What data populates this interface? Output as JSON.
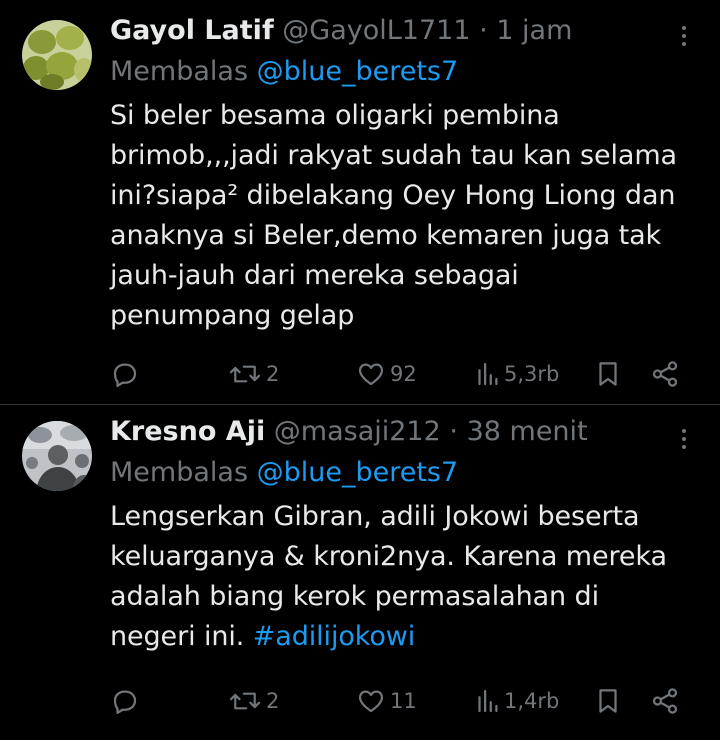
{
  "tweets": [
    {
      "name": "Gayol Latif",
      "handle": "@GayolL1711",
      "separator": "·",
      "time": "1 jam",
      "reply_prefix": "Membalas",
      "reply_to": "@blue_berets7",
      "body_lines": [
        "Si beler besama oligarki pembina",
        "brimob,,,jadi rakyat sudah tau kan selama",
        "ini?siapa² dibelakang Oey Hong Liong dan",
        "anaknya si Beler,demo kemaren juga tak",
        "jauh-jauh dari mereka sebagai",
        "penumpang gelap"
      ],
      "retweets": "2",
      "likes": "92",
      "views": "5,3rb"
    },
    {
      "name": "Kresno Aji",
      "handle": "@masaji212",
      "separator": "·",
      "time": "38 menit",
      "reply_prefix": "Membalas",
      "reply_to": "@blue_berets7",
      "body_lines": [
        "Lengserkan Gibran, adili Jokowi beserta",
        "keluarganya & kroni2nya. Karena mereka",
        "adalah biang kerok permasalahan di",
        "negeri ini."
      ],
      "hashtag": "#adilijokowi",
      "retweets": "2",
      "likes": "11",
      "views": "1,4rb"
    }
  ],
  "colors": {
    "background": "#000000",
    "text": "#e7e9ea",
    "secondary": "#71767b",
    "link": "#1d9bf0",
    "divider": "#2f3336"
  }
}
